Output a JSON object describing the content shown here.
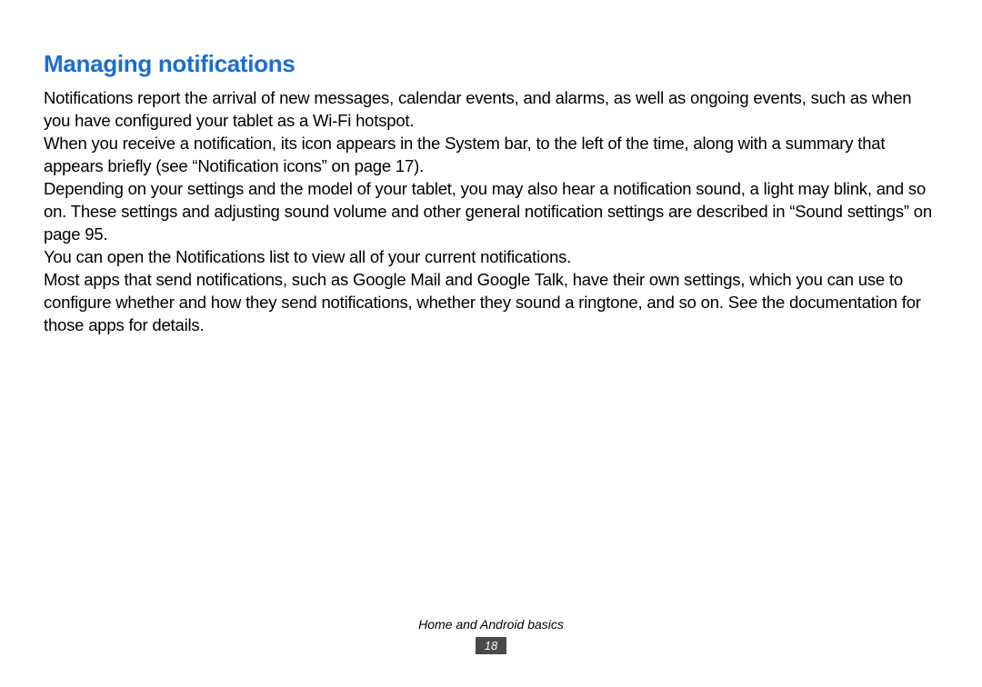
{
  "heading": "Managing notifications",
  "paragraphs": {
    "p1": "Notifications report the arrival of new messages, calendar events, and alarms, as well as ongoing events, such as when you have configured your tablet as a Wi-Fi hotspot.",
    "p2": "When you receive a notification, its icon appears in the System bar, to the left of the time, along with a summary that appears briefly (see “Notification icons” on page 17).",
    "p3": "Depending on your settings and the model of your tablet, you may also hear a notification sound, a light may blink, and so on. These settings and adjusting sound volume and other general notification settings are described in “Sound settings” on page 95.",
    "p4": "You can open the Notifications list to view all of your current notifications.",
    "p5": "Most apps that send notifications, such as Google Mail and Google Talk, have their own settings, which you can use to configure whether and how they send notifications, whether they sound a ringtone, and so on. See the documentation for those apps for details."
  },
  "footer": {
    "section": "Home and Android basics",
    "page": "18"
  }
}
